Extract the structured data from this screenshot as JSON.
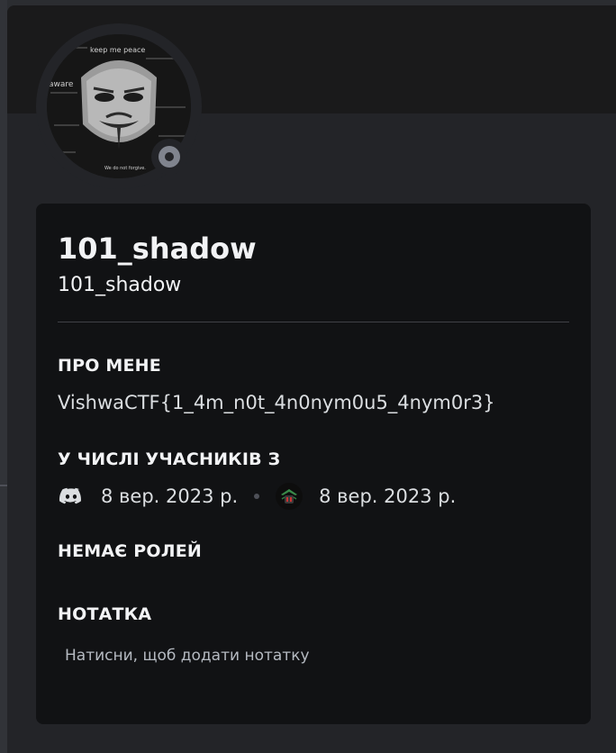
{
  "profile": {
    "display_name": "101_shadow",
    "username": "101_shadow",
    "status": "offline",
    "avatar_text": {
      "line1": "keep me peace",
      "line2": "aware",
      "line3": "We do not forgive."
    }
  },
  "about": {
    "title": "ПРО МЕНЕ",
    "text": "VishwaCTF{1_4m_n0t_4n0nym0u5_4nym0r3}"
  },
  "member_since": {
    "title": "У ЧИСЛІ УЧАСНИКІВ З",
    "discord_date": "8 вер. 2023 р.",
    "server_date": "8 вер. 2023 р."
  },
  "roles": {
    "title": "НЕМАЄ РОЛЕЙ"
  },
  "note": {
    "title": "НОТАТКА",
    "placeholder": "Натисни, щоб додати нотатку"
  },
  "colors": {
    "background": "#2b2d31",
    "card": "#111214",
    "text": "#f2f3f5",
    "muted": "#b5bac1",
    "status_offline": "#80848e"
  }
}
